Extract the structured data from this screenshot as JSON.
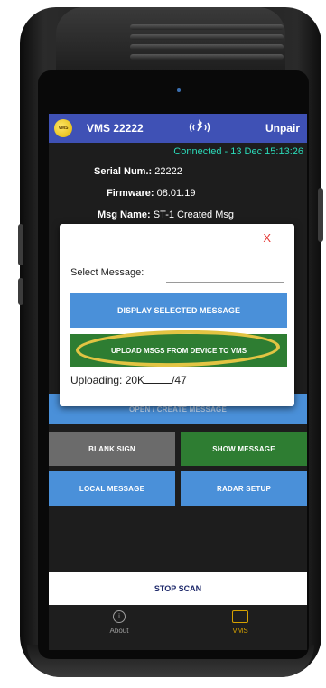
{
  "app": {
    "title": "VMS 22222",
    "unpair_label": "Unpair",
    "connection_status": "Connected - 13 Dec 15:13:26"
  },
  "device_info": {
    "serial_label": "Serial Num.:",
    "serial_value": "22222",
    "firmware_label": "Firmware:",
    "firmware_value": "08.01.19",
    "msg_name_label": "Msg Name:",
    "msg_name_value": "ST-1 Created Msg"
  },
  "dialog": {
    "close_label": "X",
    "select_label": "Select Message:",
    "display_button": "DISPLAY SELECTED MESSAGE",
    "upload_button": "UPLOAD MSGS FROM DEVICE TO VMS",
    "uploading_prefix": "Uploading: 20K",
    "uploading_suffix": "/47",
    "highlight_color": "#e2c443"
  },
  "actions": {
    "open_create": "OPEN / CREATE MESSAGE",
    "blank_sign": "BLANK SIGN",
    "show_message": "SHOW MESSAGE",
    "local_message": "LOCAL MESSAGE",
    "radar_setup": "RADAR SETUP",
    "stop_scan": "STOP SCAN"
  },
  "bottom_nav": {
    "about": "About",
    "vms": "VMS",
    "active_tab": "VMS"
  },
  "colors": {
    "appbar": "#3f51b5",
    "status_text": "#2bd9b8",
    "blue_button": "#4a90d9",
    "green_button": "#2e7d32",
    "gray_button": "#6b6b6b",
    "close_x": "#e53935",
    "nav_active": "#d6a200"
  },
  "icons": {
    "app_logo": "vms-logo-icon",
    "bluetooth": "bluetooth-icon",
    "about": "info-icon",
    "vms": "vms-sign-icon"
  }
}
